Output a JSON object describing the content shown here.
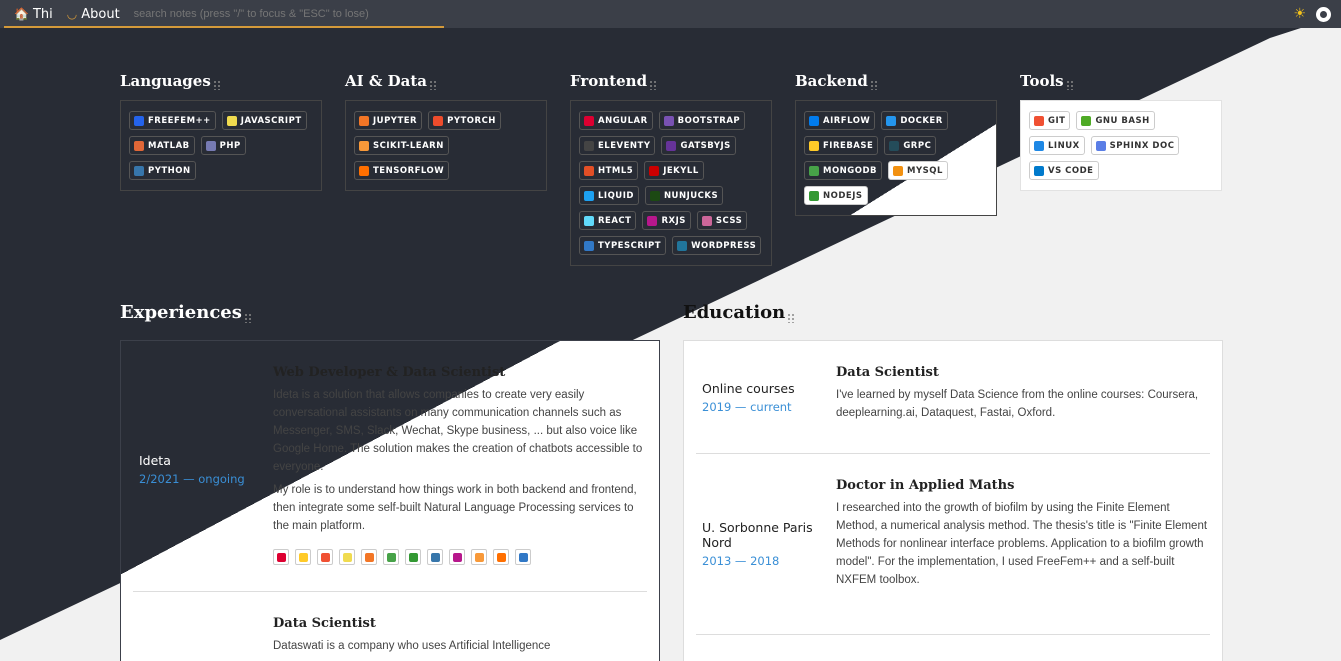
{
  "nav": {
    "home_label": "Thi",
    "about_label": "About",
    "search_placeholder": "search notes (press \"/\" to focus & \"ESC\" to lose)"
  },
  "skills": [
    {
      "title": "Languages",
      "badges": [
        {
          "label": "FREEFEM++",
          "color": "#2463eb"
        },
        {
          "label": "JAVASCRIPT",
          "color": "#f0db4f"
        },
        {
          "label": "MATLAB",
          "color": "#e16737"
        },
        {
          "label": "PHP",
          "color": "#777bb3"
        },
        {
          "label": "PYTHON",
          "color": "#3776ab"
        }
      ]
    },
    {
      "title": "AI & Data",
      "badges": [
        {
          "label": "JUPYTER",
          "color": "#f37626"
        },
        {
          "label": "PYTORCH",
          "color": "#ee4c2c"
        },
        {
          "label": "SCIKIT-LEARN",
          "color": "#f89939"
        },
        {
          "label": "TENSORFLOW",
          "color": "#ff6f00"
        }
      ]
    },
    {
      "title": "Frontend",
      "badges": [
        {
          "label": "ANGULAR",
          "color": "#dd0031"
        },
        {
          "label": "BOOTSTRAP",
          "color": "#7952b3"
        },
        {
          "label": "ELEVENTY",
          "color": "#444444"
        },
        {
          "label": "GATSBYJS",
          "color": "#663399"
        },
        {
          "label": "HTML5",
          "color": "#e34f26"
        },
        {
          "label": "JEKYLL",
          "color": "#cc0000"
        },
        {
          "label": "LIQUID",
          "color": "#1da1f2"
        },
        {
          "label": "NUNJUCKS",
          "color": "#1c4913"
        },
        {
          "label": "REACT",
          "color": "#61dafb"
        },
        {
          "label": "RXJS",
          "color": "#b7178c"
        },
        {
          "label": "SCSS",
          "color": "#cc6699"
        },
        {
          "label": "TYPESCRIPT",
          "color": "#3178c6"
        },
        {
          "label": "WORDPRESS",
          "color": "#21759b"
        }
      ]
    },
    {
      "title": "Backend",
      "badges": [
        {
          "label": "AIRFLOW",
          "color": "#017cee"
        },
        {
          "label": "DOCKER",
          "color": "#2496ed"
        },
        {
          "label": "FIREBASE",
          "color": "#ffca28"
        },
        {
          "label": "GRPC",
          "color": "#244c5a"
        },
        {
          "label": "MONGODB",
          "color": "#47a248"
        },
        {
          "label": "MYSQL",
          "color": "#f29111"
        },
        {
          "label": "NODEJS",
          "color": "#339933"
        }
      ]
    },
    {
      "title": "Tools",
      "badges": [
        {
          "label": "GIT",
          "color": "#f05032"
        },
        {
          "label": "GNU BASH",
          "color": "#4eaa25"
        },
        {
          "label": "LINUX",
          "color": "#1e88e5"
        },
        {
          "label": "SPHINX DOC",
          "color": "#5a7ee6"
        },
        {
          "label": "VS CODE",
          "color": "#007acc"
        }
      ]
    }
  ],
  "experiences": {
    "title": "Experiences",
    "items": [
      {
        "company": "Ideta",
        "date": "2/2021 — ongoing",
        "role": "Web Developer & Data Scientist",
        "paragraphs": [
          "Ideta is a solution that allows companies to create very easily conversational assistants on many communication channels such as Messenger, SMS, Slack, Wechat, Skype business, ... but also voice like Google Home. The solution makes the creation of chatbots accessible to everyone.",
          "My role is to understand how things work in both backend and frontend, then integrate some self-built Natural Language Processing services to the main platform."
        ],
        "tech_icons": [
          {
            "name": "angular-icon",
            "color": "#dd0031"
          },
          {
            "name": "firebase-icon",
            "color": "#ffca28"
          },
          {
            "name": "git-icon",
            "color": "#f05032"
          },
          {
            "name": "javascript-icon",
            "color": "#f0db4f"
          },
          {
            "name": "jupyter-icon",
            "color": "#f37626"
          },
          {
            "name": "mongodb-icon",
            "color": "#47a248"
          },
          {
            "name": "nodejs-icon",
            "color": "#339933"
          },
          {
            "name": "python-icon",
            "color": "#3776ab"
          },
          {
            "name": "rxjs-icon",
            "color": "#b7178c"
          },
          {
            "name": "scikit-learn-icon",
            "color": "#f89939"
          },
          {
            "name": "tensorflow-icon",
            "color": "#ff6f00"
          },
          {
            "name": "typescript-icon",
            "color": "#3178c6"
          }
        ]
      },
      {
        "role": "Data Scientist",
        "text": "Dataswati is a company who uses Artificial Intelligence"
      }
    ]
  },
  "education": {
    "title": "Education",
    "items": [
      {
        "place": "Online courses",
        "date": "2019 — current",
        "degree": "Data Scientist",
        "text": "I've learned by myself Data Science from the online courses: Coursera, deeplearning.ai, Dataquest, Fastai, Oxford."
      },
      {
        "place": "U. Sorbonne Paris Nord",
        "date": "2013 — 2018",
        "degree": "Doctor in Applied Maths",
        "text": "I researched into the growth of biofilm by using the Finite Element Method, a numerical analysis method. The thesis's title is \"Finite Element Methods for nonlinear interface problems. Application to a biofilm growth model\". For the implementation, I used FreeFem++ and a self-built NXFEM toolbox."
      }
    ]
  },
  "colors": {
    "dark_bg": "#282c35",
    "light_bg": "#f1f1f1",
    "accent": "#d49a3a",
    "date_blue": "#3a8fd6"
  }
}
